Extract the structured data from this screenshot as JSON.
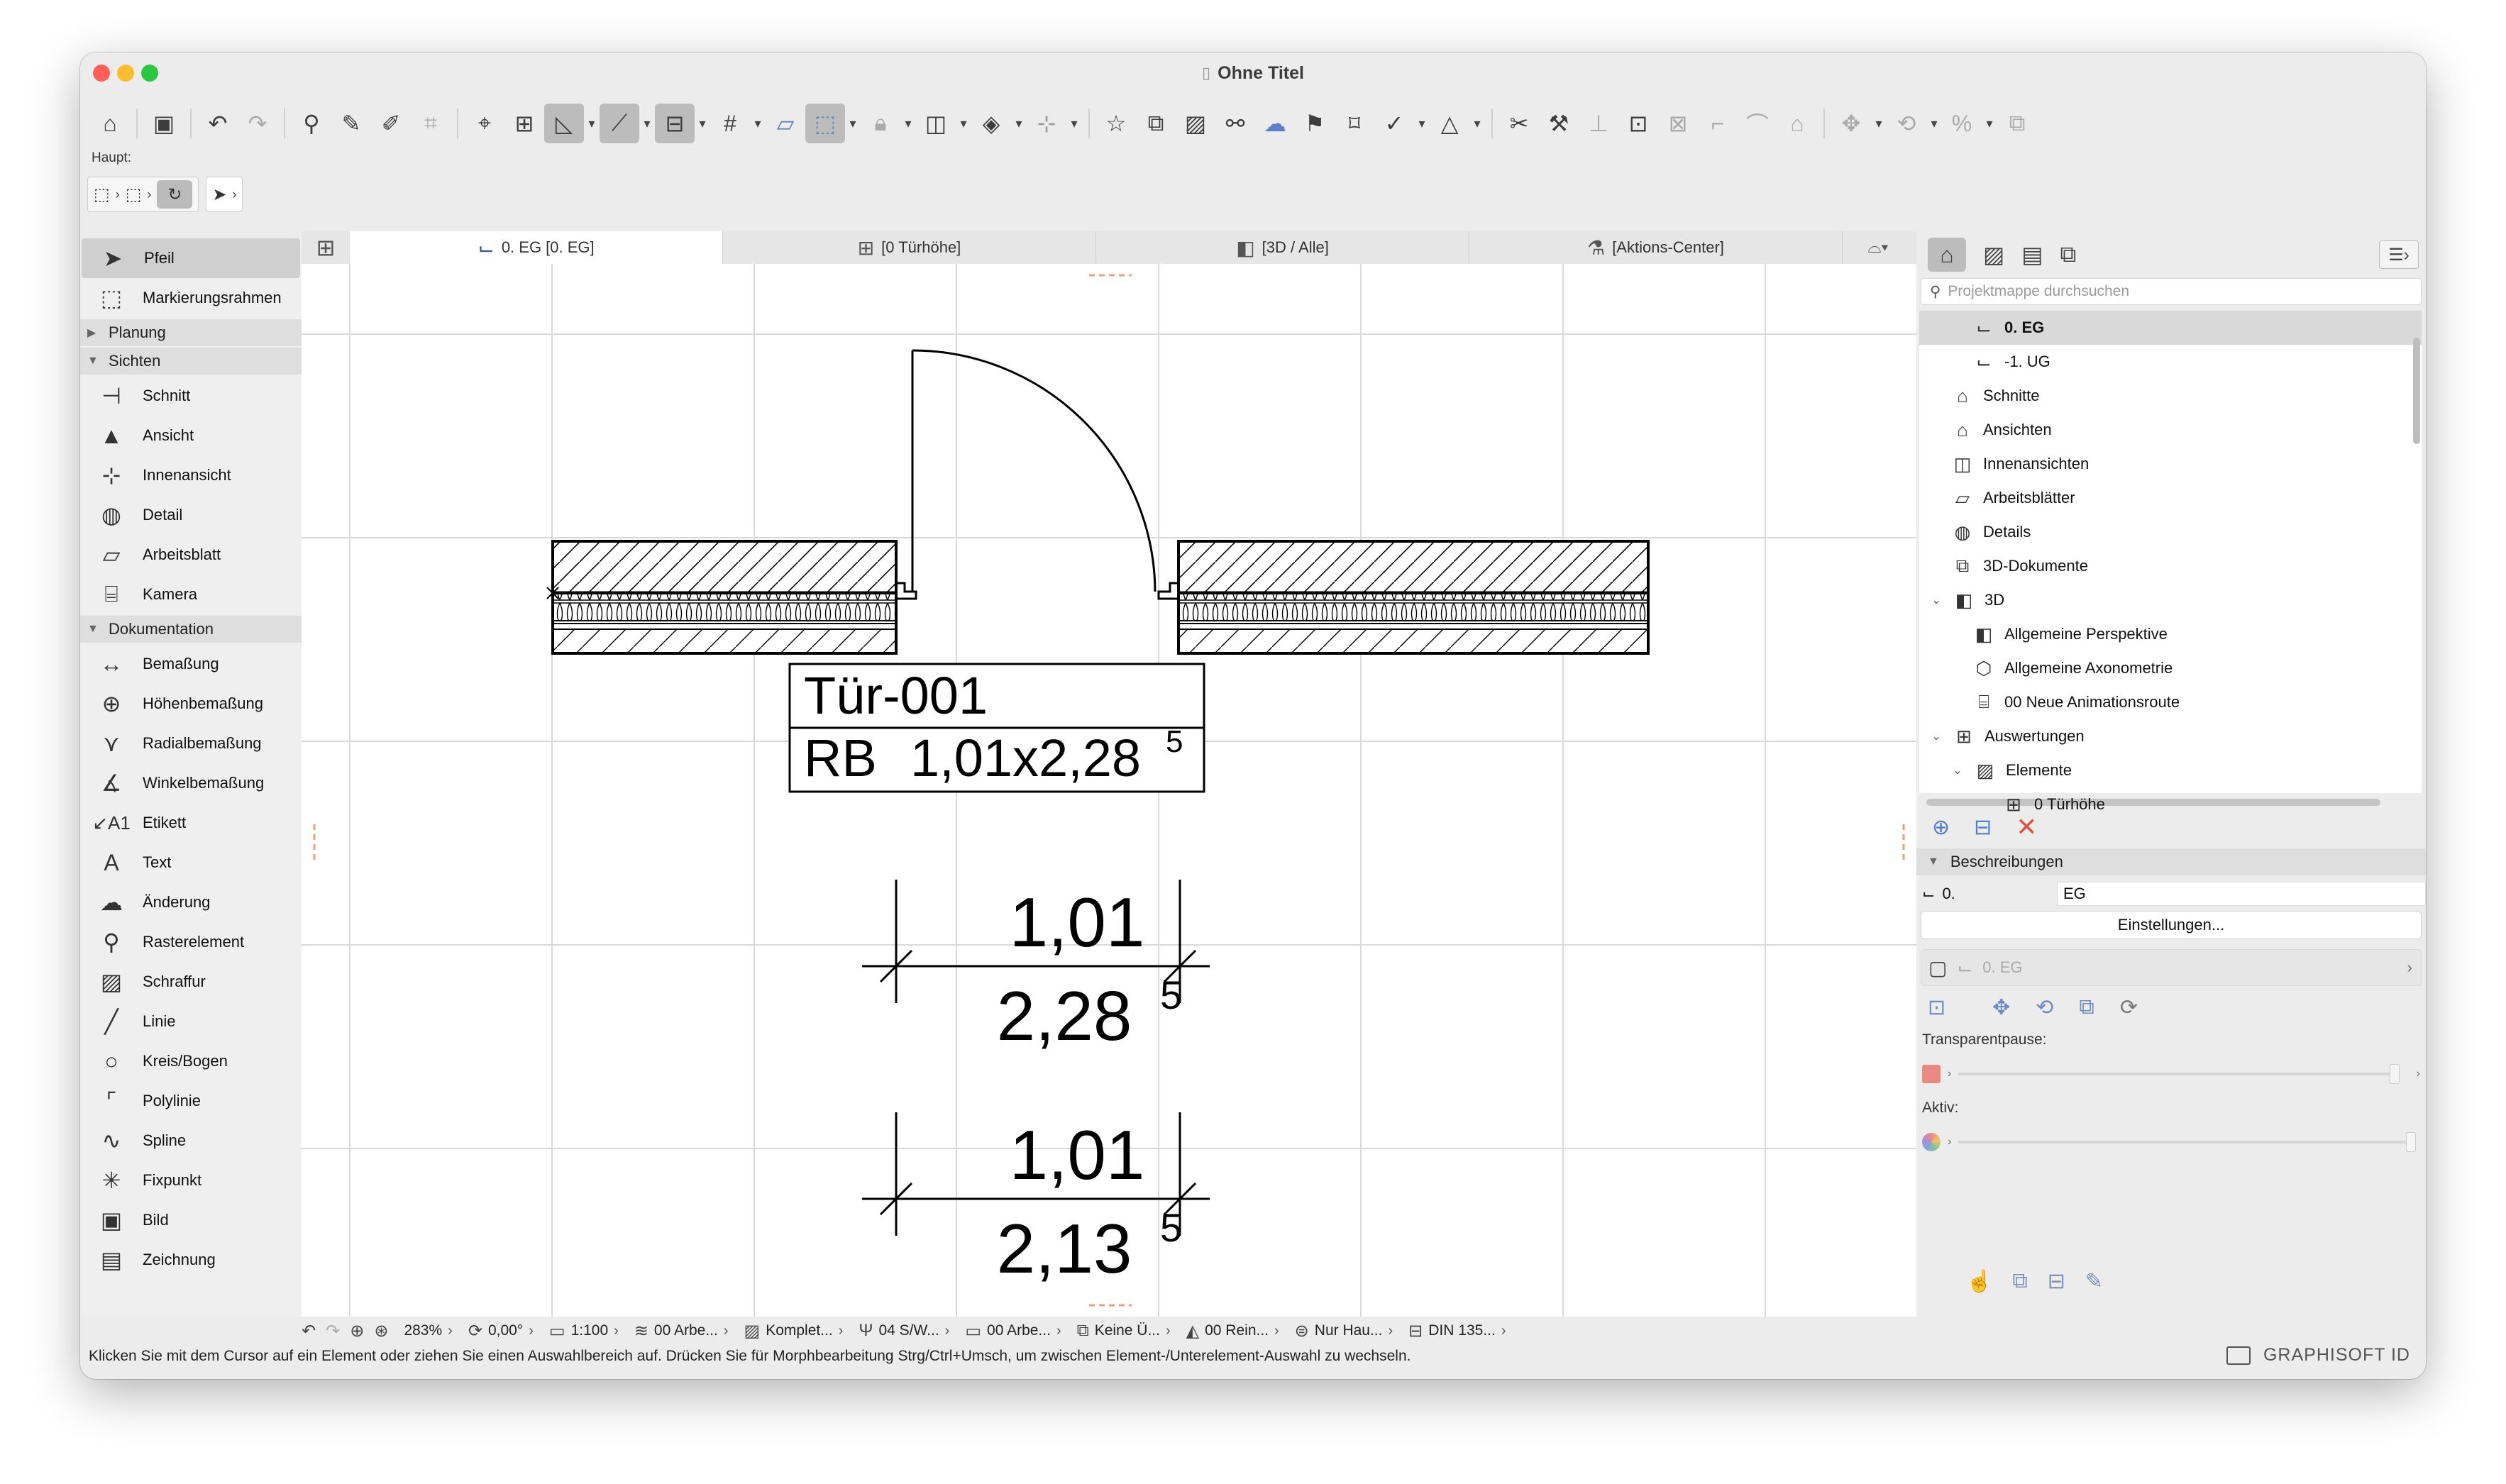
{
  "window": {
    "title": "Ohne Titel"
  },
  "toolbar": {
    "label": "Haupt:"
  },
  "toolbox": {
    "tools_top": [
      {
        "label": "Pfeil",
        "icon": "arrow-pointer-icon"
      },
      {
        "label": "Markierungsrahmen",
        "icon": "marquee-icon"
      }
    ],
    "categories": [
      {
        "label": "Planung",
        "expanded": false
      },
      {
        "label": "Sichten",
        "expanded": true
      },
      {
        "label": "Dokumentation",
        "expanded": true
      }
    ],
    "sichten": [
      {
        "label": "Schnitt",
        "icon": "section-icon"
      },
      {
        "label": "Ansicht",
        "icon": "elevation-icon"
      },
      {
        "label": "Innenansicht",
        "icon": "interior-elevation-icon"
      },
      {
        "label": "Detail",
        "icon": "detail-icon"
      },
      {
        "label": "Arbeitsblatt",
        "icon": "worksheet-icon"
      },
      {
        "label": "Kamera",
        "icon": "camera-icon"
      }
    ],
    "dokumentation": [
      {
        "label": "Bemaßung",
        "icon": "dimension-icon"
      },
      {
        "label": "Höhenbemaßung",
        "icon": "level-dimension-icon"
      },
      {
        "label": "Radialbemaßung",
        "icon": "radial-dimension-icon"
      },
      {
        "label": "Winkelbemaßung",
        "icon": "angle-dimension-icon"
      },
      {
        "label": "Etikett",
        "icon": "label-icon"
      },
      {
        "label": "Text",
        "icon": "text-icon"
      },
      {
        "label": "Änderung",
        "icon": "change-icon"
      },
      {
        "label": "Rasterelement",
        "icon": "grid-element-icon"
      },
      {
        "label": "Schraffur",
        "icon": "fill-icon"
      },
      {
        "label": "Linie",
        "icon": "line-icon"
      },
      {
        "label": "Kreis/Bogen",
        "icon": "circle-icon"
      },
      {
        "label": "Polylinie",
        "icon": "polyline-icon"
      },
      {
        "label": "Spline",
        "icon": "spline-icon"
      },
      {
        "label": "Fixpunkt",
        "icon": "hotspot-icon"
      },
      {
        "label": "Bild",
        "icon": "image-icon"
      },
      {
        "label": "Zeichnung",
        "icon": "drawing-icon"
      }
    ]
  },
  "tabs": [
    {
      "label": "0. EG [0. EG]",
      "active": true
    },
    {
      "label": "[0 Türhöhe]",
      "active": false
    },
    {
      "label": "[3D / Alle]",
      "active": false
    },
    {
      "label": "[Aktions-Center]",
      "active": false
    }
  ],
  "drawing": {
    "door_id": "Tür-001",
    "rb_label": "RB",
    "rb_main": "1,01x2,28",
    "rb_sup": "5",
    "dim1_top": "1,01",
    "dim1_bottom": "2,28",
    "dim1_sup": "5",
    "dim2_top": "1,01",
    "dim2_bottom": "2,13",
    "dim2_sup": "5"
  },
  "statusbar": {
    "zoom": "283%",
    "angle": "0,00°",
    "scale": "1:100",
    "layer_combo": "00 Arbe...",
    "model_view": "Komplet...",
    "pen_set": "04 S/W...",
    "display_option": "00 Arbe...",
    "renovation": "Keine Ü...",
    "renovation_filter": "00 Rein...",
    "structure": "Nur Hau...",
    "dimension_standard": "DIN 135..."
  },
  "hint": "Klicken Sie mit dem Cursor auf ein Element oder ziehen Sie einen Auswahlbereich auf. Drücken Sie für Morphbearbeitung Strg/Ctrl+Umsch, um zwischen Element-/Unterelement-Auswahl zu wechseln.",
  "brand": "GRAPHISOFT ID",
  "navigator": {
    "search_placeholder": "Projektmappe durchsuchen",
    "tree": [
      {
        "label": "0. EG",
        "indent": 2,
        "bold": true,
        "selected": true,
        "icon": "story-icon"
      },
      {
        "label": "-1. UG",
        "indent": 2,
        "icon": "story-icon"
      },
      {
        "label": "Schnitte",
        "indent": 1,
        "icon": "sections-folder-icon"
      },
      {
        "label": "Ansichten",
        "indent": 1,
        "icon": "elevations-folder-icon"
      },
      {
        "label": "Innenansichten",
        "indent": 1,
        "icon": "interior-elevations-icon"
      },
      {
        "label": "Arbeitsblätter",
        "indent": 1,
        "icon": "worksheets-icon"
      },
      {
        "label": "Details",
        "indent": 1,
        "icon": "details-icon"
      },
      {
        "label": "3D-Dokumente",
        "indent": 1,
        "icon": "3d-documents-icon"
      },
      {
        "label": "3D",
        "indent": 1,
        "disclosure": "open",
        "icon": "3d-icon"
      },
      {
        "label": "Allgemeine Perspektive",
        "indent": 2,
        "icon": "perspective-icon"
      },
      {
        "label": "Allgemeine Axonometrie",
        "indent": 2,
        "icon": "axonometry-icon"
      },
      {
        "label": "00 Neue Animationsroute",
        "indent": 2,
        "icon": "camera-path-icon"
      },
      {
        "label": "Auswertungen",
        "indent": 1,
        "disclosure": "open",
        "icon": "schedules-icon"
      },
      {
        "label": "Elemente",
        "indent": 2,
        "disclosure": "open",
        "icon": "elements-icon"
      },
      {
        "label": "0 Türhöhe",
        "indent": 3,
        "icon": "schedule-table-icon"
      }
    ],
    "descriptions_header": "Beschreibungen",
    "desc_key": "0.",
    "desc_value": "EG",
    "settings_button": "Einstellungen...",
    "layer_row_label": "0. EG",
    "transparent_label": "Transparentpause:",
    "active_label": "Aktiv:",
    "accent_red": "#e0533f"
  }
}
